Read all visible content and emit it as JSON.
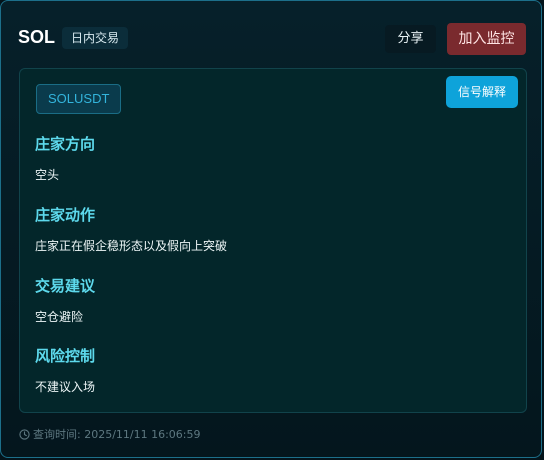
{
  "header": {
    "symbol": "SOL",
    "tag": "日内交易",
    "share_label": "分享",
    "watch_label": "加入监控"
  },
  "panel": {
    "pair": "SOLUSDT",
    "explain_label": "信号解释",
    "sections": [
      {
        "title": "庄家方向",
        "text": "空头"
      },
      {
        "title": "庄家动作",
        "text": "庄家正在假企稳形态以及假向上突破"
      },
      {
        "title": "交易建议",
        "text": "空仓避险"
      },
      {
        "title": "风险控制",
        "text": "不建议入场"
      }
    ]
  },
  "footer": {
    "query_time": "查询时间: 2025/11/11 16:06:59"
  },
  "colors": {
    "accent": "#5dd9ec",
    "watch_button": "#7a2a2e",
    "explain_button": "#0ea3da"
  },
  "icons": {
    "footer": "clock-icon"
  }
}
